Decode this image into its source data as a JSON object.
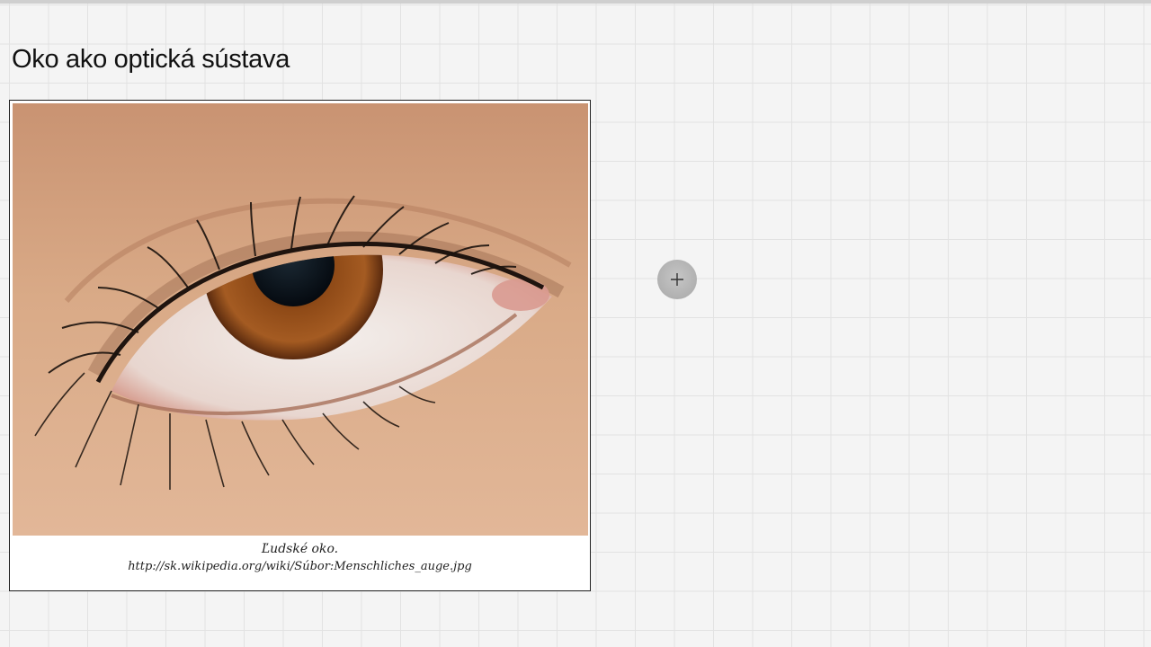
{
  "slide": {
    "title": "Oko ako optická sústava"
  },
  "figure": {
    "image_subject": "close-up photograph of a human brown eye",
    "caption_line1": "Ľudské oko.",
    "caption_line2": "http://sk.wikipedia.org/wiki/Súbor:Menschliches_auge.jpg"
  },
  "pointer": {
    "icon": "crosshair-cursor-icon"
  },
  "colors": {
    "background": "#f4f4f4",
    "grid_line": "#e2e2e2",
    "skin": "#d5a583",
    "iris": "#8a4a1e",
    "pupil": "#0b1720"
  }
}
